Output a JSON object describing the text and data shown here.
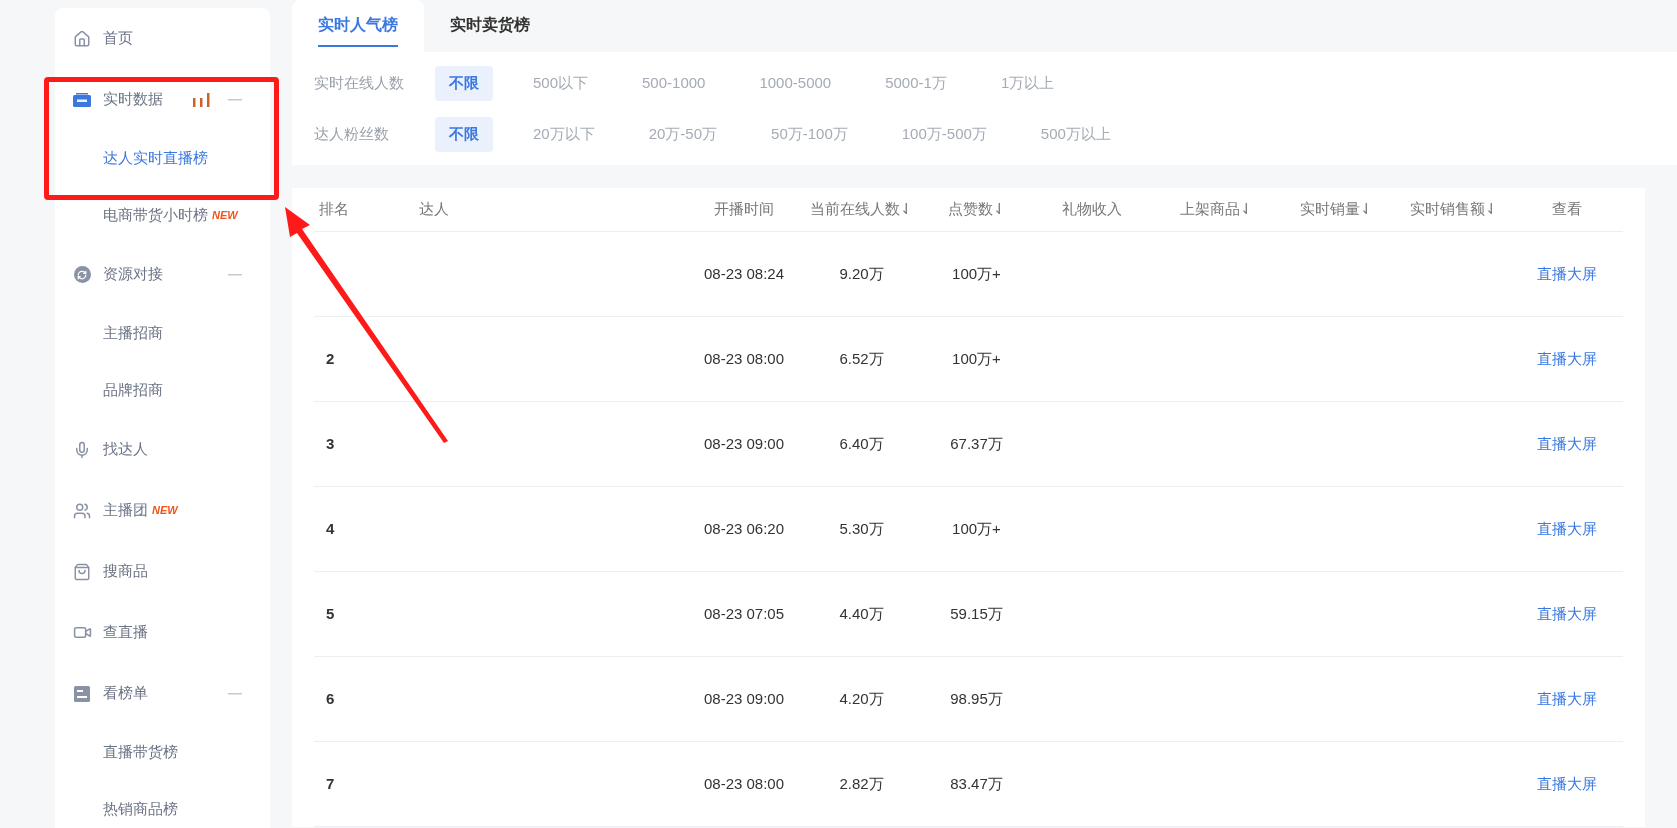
{
  "sidebar": {
    "items": [
      {
        "label": "首页",
        "selected": false
      },
      {
        "label": "实时数据",
        "live": true,
        "expanded": true,
        "children": [
          {
            "label": "达人实时直播榜",
            "selected": true
          },
          {
            "label": "电商带货小时榜",
            "selected": false,
            "badge": "NEW"
          }
        ]
      },
      {
        "label": "资源对接",
        "expanded": true,
        "children": [
          {
            "label": "主播招商",
            "selected": false
          },
          {
            "label": "品牌招商",
            "selected": false
          }
        ]
      },
      {
        "label": "找达人",
        "selected": false
      },
      {
        "label": "主播团",
        "selected": false,
        "badge": "NEW"
      },
      {
        "label": "搜商品",
        "selected": false
      },
      {
        "label": "查直播",
        "selected": false
      },
      {
        "label": "看榜单",
        "expanded": true,
        "children": [
          {
            "label": "直播带货榜",
            "selected": false
          },
          {
            "label": "热销商品榜",
            "selected": false
          }
        ]
      }
    ]
  },
  "tabs": [
    {
      "label": "实时人气榜",
      "selected": true
    },
    {
      "label": "实时卖货榜",
      "selected": false
    }
  ],
  "filters": [
    {
      "label": "实时在线人数",
      "options": [
        {
          "label": "不限",
          "selected": true
        },
        {
          "label": "500以下",
          "selected": false
        },
        {
          "label": "500-1000",
          "selected": false
        },
        {
          "label": "1000-5000",
          "selected": false
        },
        {
          "label": "5000-1万",
          "selected": false
        },
        {
          "label": "1万以上",
          "selected": false
        }
      ]
    },
    {
      "label": "达人粉丝数",
      "options": [
        {
          "label": "不限",
          "selected": true
        },
        {
          "label": "20万以下",
          "selected": false
        },
        {
          "label": "20万-50万",
          "selected": false
        },
        {
          "label": "50万-100万",
          "selected": false
        },
        {
          "label": "100万-500万",
          "selected": false
        },
        {
          "label": "500万以上",
          "selected": false
        }
      ]
    }
  ],
  "table": {
    "columns": [
      "排名",
      "达人",
      "开播时间",
      "当前在线人数⇃",
      "点赞数⇃",
      "礼物收入",
      "上架商品⇃",
      "实时销量⇃",
      "实时销售额⇃",
      "查看"
    ],
    "rows": [
      {
        "start_time": "08-23 08:24",
        "online": "9.20万",
        "likes": "100万+",
        "action": "直播大屏"
      },
      {
        "rank": "2",
        "start_time": "08-23 08:00",
        "online": "6.52万",
        "likes": "100万+",
        "action": "直播大屏"
      },
      {
        "rank": "3",
        "start_time": "08-23 09:00",
        "online": "6.40万",
        "likes": "67.37万",
        "action": "直播大屏"
      },
      {
        "rank": "4",
        "start_time": "08-23 06:20",
        "online": "5.30万",
        "likes": "100万+",
        "action": "直播大屏"
      },
      {
        "rank": "5",
        "start_time": "08-23 07:05",
        "online": "4.40万",
        "likes": "59.15万",
        "action": "直播大屏"
      },
      {
        "rank": "6",
        "start_time": "08-23 09:00",
        "online": "4.20万",
        "likes": "98.95万",
        "action": "直播大屏"
      },
      {
        "rank": "7",
        "start_time": "08-23 08:00",
        "online": "2.82万",
        "likes": "83.47万",
        "action": "直播大屏"
      }
    ]
  }
}
